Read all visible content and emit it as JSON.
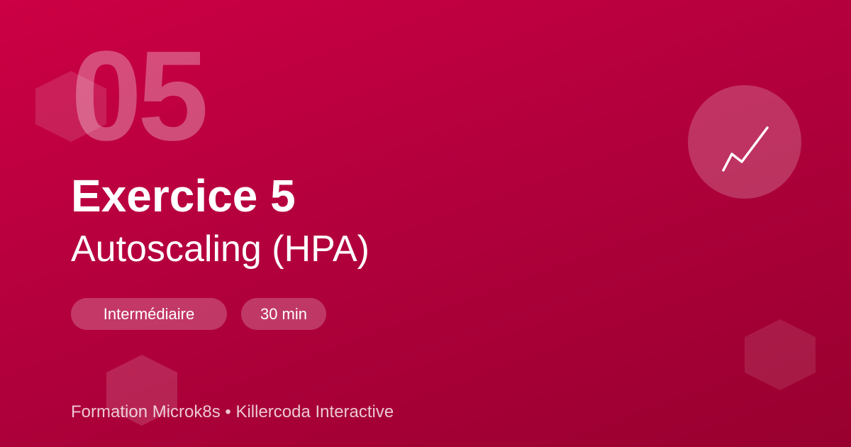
{
  "hero": {
    "number": "05",
    "title": "Exercice 5",
    "subtitle": "Autoscaling (HPA)"
  },
  "badges": {
    "level": "Intermédiaire",
    "duration": "30 min"
  },
  "icon": {
    "name": "trending-up-icon"
  },
  "footer": {
    "text": "Formation Microk8s • Killercoda Interactive"
  },
  "colors": {
    "background_start": "#cc0044",
    "background_end": "#98002f",
    "text": "#ffffff"
  }
}
